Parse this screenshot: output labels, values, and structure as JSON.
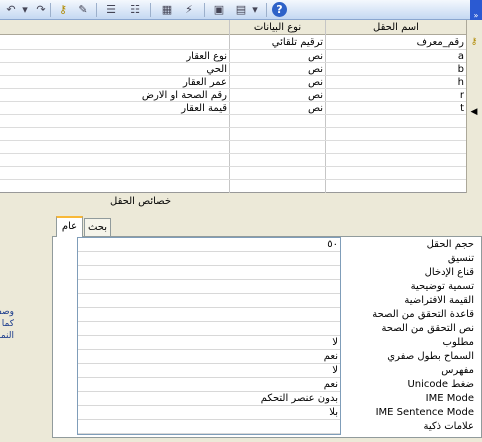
{
  "toolbar": {
    "icons": [
      "undo-icon",
      "redo-icon",
      "key-icon",
      "builder-icon",
      "insert-rows-icon",
      "delete-rows-icon",
      "properties-icon",
      "indexes-icon",
      "database-window-icon",
      "new-object-icon",
      "help-icon"
    ],
    "overflow_glyph": "»"
  },
  "grid": {
    "headers": {
      "field_name": "اسم الحقل",
      "data_type": "نوع البيانات"
    },
    "rows": [
      {
        "selector": "key",
        "field": "رقم_معرف",
        "type": "ترقيم تلقائي",
        "desc": ""
      },
      {
        "selector": "",
        "field": "a",
        "type": "نص",
        "desc": "نوع العقار"
      },
      {
        "selector": "",
        "field": "b",
        "type": "نص",
        "desc": "الحي"
      },
      {
        "selector": "",
        "field": "h",
        "type": "نص",
        "desc": "عمر العقار"
      },
      {
        "selector": "",
        "field": "r",
        "type": "نص",
        "desc": "رقم الصحة او الارض"
      },
      {
        "selector": "current",
        "field": "t",
        "type": "نص",
        "desc": "قيمة العقار"
      }
    ]
  },
  "field_properties": {
    "title": "خصائص الحقل",
    "tabs": {
      "general": "عام",
      "lookup": "بحث"
    },
    "hint_lines": [
      "وصف ال",
      "كما أنه ي",
      "النموذ"
    ],
    "properties": [
      {
        "label": "حجم الحقل",
        "value": "٥٠"
      },
      {
        "label": "تنسيق",
        "value": ""
      },
      {
        "label": "قناع الإدخال",
        "value": ""
      },
      {
        "label": "تسمية توضيحية",
        "value": ""
      },
      {
        "label": "القيمة الافتراضية",
        "value": ""
      },
      {
        "label": "قاعدة التحقق من الصحة",
        "value": ""
      },
      {
        "label": "نص التحقق من الصحة",
        "value": ""
      },
      {
        "label": "مطلوب",
        "value": "لا"
      },
      {
        "label": "السماح بطول صفري",
        "value": "نعم"
      },
      {
        "label": "مفهرس",
        "value": "لا"
      },
      {
        "label": "ضغط Unicode",
        "value": "نعم"
      },
      {
        "label": "IME Mode",
        "value": "بدون عنصر التحكم"
      },
      {
        "label": "IME Sentence Mode",
        "value": "بلا"
      },
      {
        "label": "علامات ذكية",
        "value": ""
      }
    ]
  },
  "colors": {
    "accent": "#f8b838",
    "toolbar_edge": "#2b5ad2"
  }
}
